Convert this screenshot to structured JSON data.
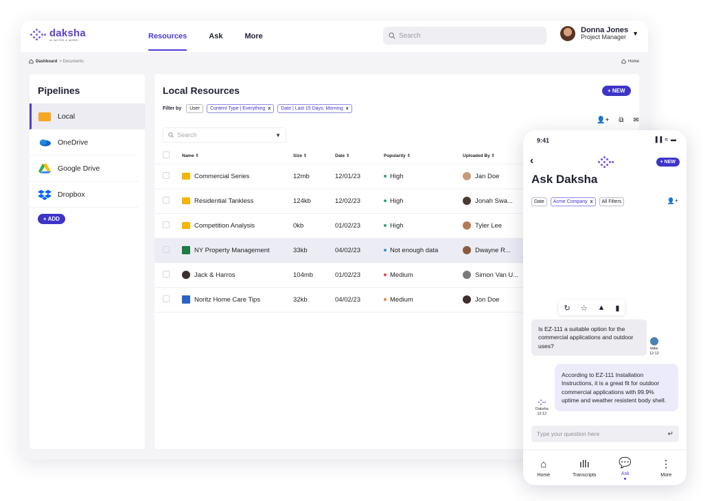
{
  "brand": {
    "name": "daksha",
    "tagline": "AI NOTES & MORE..."
  },
  "nav": {
    "items": [
      "Resources",
      "Ask",
      "More"
    ],
    "active": "Resources"
  },
  "search": {
    "placeholder": "Search"
  },
  "user": {
    "name": "Donna Jones",
    "role": "Project Manager"
  },
  "breadcrumb": {
    "root": "Dashboard",
    "current": "> Documents",
    "home": "Home"
  },
  "sidebar": {
    "title": "Pipelines",
    "items": [
      {
        "label": "Local",
        "icon": "local-folder-icon",
        "active": true
      },
      {
        "label": "OneDrive",
        "icon": "onedrive-icon"
      },
      {
        "label": "Google Drive",
        "icon": "google-drive-icon"
      },
      {
        "label": "Dropbox",
        "icon": "dropbox-icon"
      }
    ],
    "add_label": "+ ADD"
  },
  "main": {
    "title": "Local Resources",
    "new_label": "+ NEW",
    "filter_label": "Filter by",
    "filters": [
      {
        "label": "User",
        "removable": false
      },
      {
        "label": "Content Type | Everything",
        "removable": true
      },
      {
        "label": "Date | Last 15 Days, Morning",
        "removable": true
      }
    ],
    "table_search_placeholder": "Search",
    "columns": [
      "Name ⇕",
      "Size ⇕",
      "Date ⇕",
      "Popularity ⇕",
      "Uploaded By ⇕"
    ],
    "rows": [
      {
        "name": "Commercial Series",
        "type": "folder",
        "size": "12mb",
        "date": "12/01/23",
        "popularity": "High",
        "pop_color": "#2fa36b",
        "uploader": "Jan Doe",
        "av": "#c69a7a"
      },
      {
        "name": "Residential Tankless",
        "type": "folder",
        "size": "124kb",
        "date": "12/02/23",
        "popularity": "High",
        "pop_color": "#2fa36b",
        "uploader": "Jonah Swa...",
        "av": "#4a3a33"
      },
      {
        "name": "Competition Analysis",
        "type": "folder",
        "size": "0kb",
        "date": "01/02/23",
        "popularity": "High",
        "pop_color": "#2fa36b",
        "uploader": "Tyler Lee",
        "av": "#b27a55"
      },
      {
        "name": "NY Property Management",
        "type": "excel",
        "size": "33kb",
        "date": "04/02/23",
        "popularity": "Not enough data",
        "pop_color": "#3d8fd6",
        "uploader": "Dwayne R...",
        "av": "#8b5a3c",
        "highlight": true
      },
      {
        "name": "Jack & Harros",
        "type": "round",
        "size": "104mb",
        "date": "01/02/23",
        "popularity": "Medium",
        "pop_color": "#e0463b",
        "uploader": "Simon Van U...",
        "av": "#7a7a7a"
      },
      {
        "name": "Noritz Home Care Tips",
        "type": "word",
        "size": "32kb",
        "date": "04/02/23",
        "popularity": "Medium",
        "pop_color": "#e58a2e",
        "uploader": "Jon Doe",
        "av": "#3f2f2a"
      }
    ]
  },
  "phone": {
    "time": "9:41",
    "status": "▐▐ ≈ ▬",
    "new_label": "+ NEW",
    "title": "Ask Daksha",
    "filters": [
      {
        "label": "Date",
        "removable": false
      },
      {
        "label": "Acme Company",
        "removable": true
      },
      {
        "label": "All Filters",
        "removable": false
      }
    ],
    "messages": [
      {
        "from": "Mike",
        "time": "12:12",
        "text": "Is EZ-111 a suitable option for the commercial applications and outdoor uses?"
      },
      {
        "from": "Daksha",
        "time": "12:12",
        "text": "According to EZ-111 Installation Instructions, it is a great fit for outdoor commercial applications with 99.9% uptime and weather resistent body shell."
      }
    ],
    "input_placeholder": "Type your question here",
    "bottom_nav": [
      {
        "label": "Home",
        "icon": "home-icon"
      },
      {
        "label": "Transcripts",
        "icon": "waveform-icon"
      },
      {
        "label": "Ask",
        "icon": "chat-icon",
        "active": true
      },
      {
        "label": "More",
        "icon": "more-vertical-icon"
      }
    ]
  },
  "colors": {
    "accent": "#3d34c9",
    "brand": "#5b3fd1",
    "folder": "#f5b400"
  }
}
